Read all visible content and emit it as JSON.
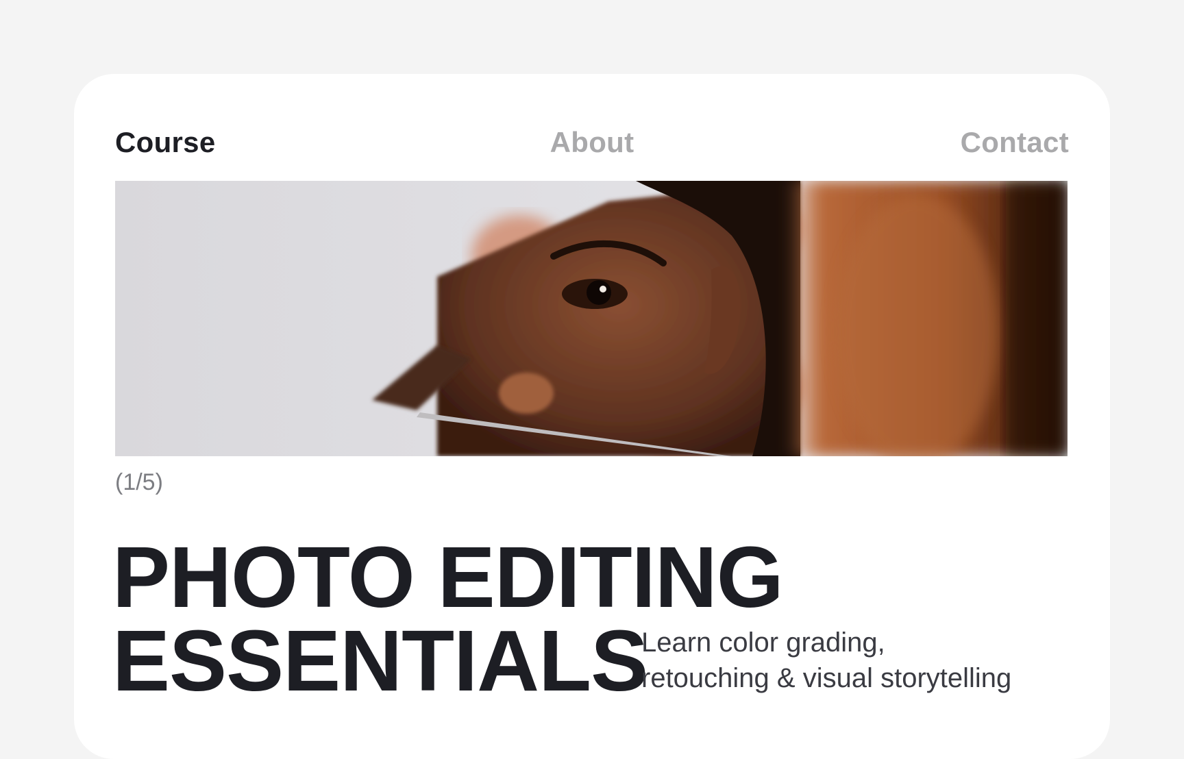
{
  "nav": {
    "items": [
      {
        "label": "Course",
        "active": true
      },
      {
        "label": "About",
        "active": false
      },
      {
        "label": "Contact",
        "active": false
      }
    ]
  },
  "hero": {
    "image_icon": "photo-portrait-mirror",
    "counter": "(1/5)"
  },
  "title": {
    "line1": "PHOTO EDITING",
    "line2": "ESSENTIALS"
  },
  "subtitle": {
    "line1": "Learn color grading,",
    "line2": "retouching & visual storytelling"
  },
  "colors": {
    "background": "#f4f4f4",
    "card": "#ffffff",
    "text_dark": "#1d1e24",
    "text_muted": "#a9a9ab"
  }
}
